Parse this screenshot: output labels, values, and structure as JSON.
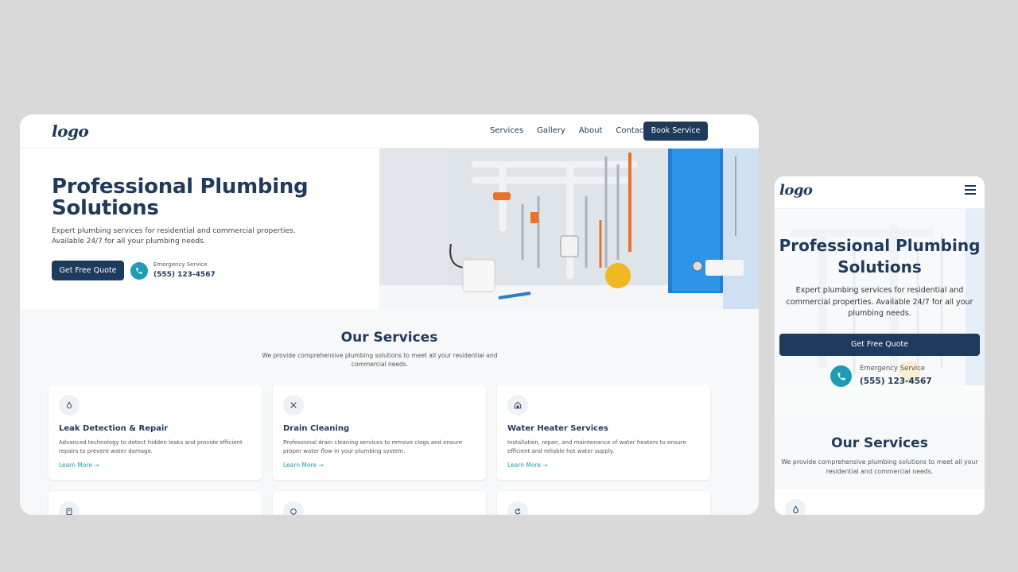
{
  "desktop": {
    "nav": {
      "logo": "logo",
      "links": [
        "Services",
        "Gallery",
        "About",
        "Contact"
      ],
      "book_label": "Book Service"
    },
    "hero": {
      "title": "Professional Plumbing Solutions",
      "subtitle": "Expert plumbing services for residential and commercial properties. Available 24/7 for all your plumbing needs.",
      "quote_label": "Get Free Quote",
      "emergency_label": "Emergency Service",
      "phone": "(555) 123-4567"
    },
    "services": {
      "title": "Our Services",
      "subtitle": "We provide comprehensive plumbing solutions to meet all your residential and commercial needs.",
      "learn_more": "Learn More →",
      "cards": [
        {
          "title": "Leak Detection & Repair",
          "desc": "Advanced technology to detect hidden leaks and provide efficient repairs to prevent water damage.",
          "icon": "droplet-icon"
        },
        {
          "title": "Drain Cleaning",
          "desc": "Professional drain cleaning services to remove clogs and ensure proper water flow in your plumbing system.",
          "icon": "tools-icon"
        },
        {
          "title": "Water Heater Services",
          "desc": "Installation, repair, and maintenance of water heaters to ensure efficient and reliable hot water supply.",
          "icon": "house-icon"
        }
      ],
      "row2_icons": [
        "clipboard-icon",
        "circle-icon",
        "refresh-icon"
      ]
    }
  },
  "mobile": {
    "nav": {
      "logo": "logo",
      "menu_icon": "hamburger-icon"
    },
    "hero": {
      "title": "Professional Plumbing Solutions",
      "subtitle": "Expert plumbing services for residential and commercial properties. Available 24/7 for all your plumbing needs.",
      "quote_label": "Get Free Quote",
      "emergency_label": "Emergency Service",
      "phone": "(555) 123-4567"
    },
    "services": {
      "title": "Our Services",
      "subtitle": "We provide comprehensive plumbing solutions to meet all your residential and commercial needs.",
      "first_icon": "droplet-icon"
    }
  },
  "colors": {
    "navy": "#1e3a5c",
    "teal": "#1f9bb5",
    "page_bg": "#d9d9d9",
    "section_bg": "#f7f8fa"
  }
}
